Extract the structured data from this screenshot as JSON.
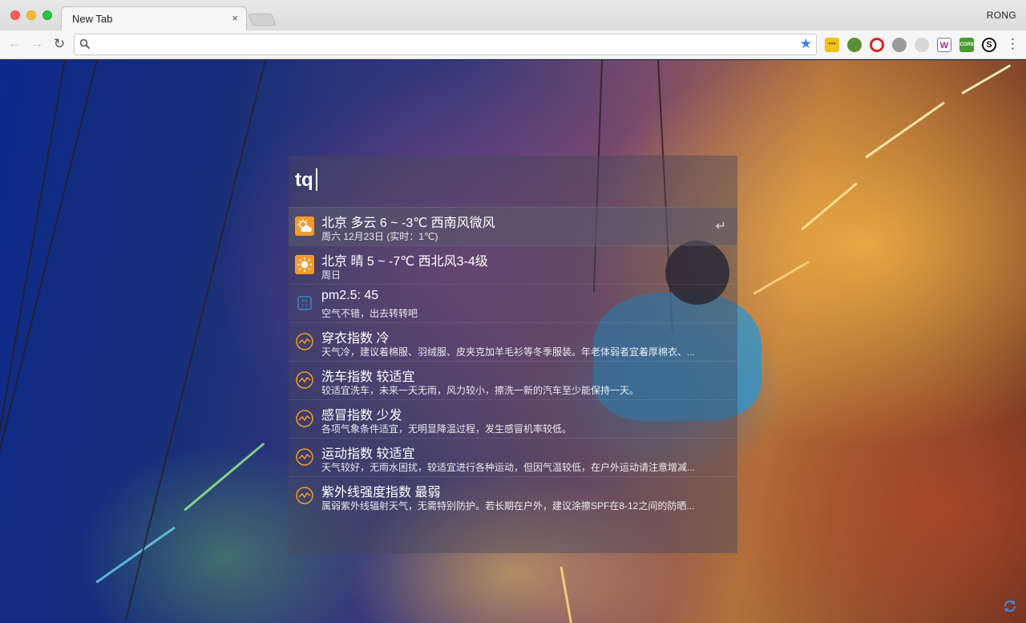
{
  "browser": {
    "tab_title": "New Tab",
    "tab_close": "×",
    "profile_name": "RONG",
    "omnibox_value": "",
    "nav": {
      "back": "←",
      "forward": "→",
      "reload": "↻"
    },
    "star": "★",
    "menu": "⋮",
    "extensions": [
      {
        "name": "notes-extension-icon",
        "glyph": "▪▪▪"
      },
      {
        "name": "apple-extension-icon",
        "glyph": ""
      },
      {
        "name": "opera-extension-icon",
        "glyph": ""
      },
      {
        "name": "compass-extension-icon",
        "glyph": ""
      },
      {
        "name": "cloud-extension-icon",
        "glyph": ""
      },
      {
        "name": "word-extension-icon",
        "glyph": "W"
      },
      {
        "name": "cors-extension-icon",
        "glyph": "CORS"
      },
      {
        "name": "s-extension-icon",
        "glyph": "S"
      }
    ]
  },
  "launcher": {
    "query": "tq",
    "enter_hint": "↵",
    "results": [
      {
        "icon": "partly-cloudy-icon",
        "title": "北京 多云 6 ~ -3℃ 西南风微风",
        "subtitle": "周六 12月23日 (实时：1℃)",
        "selected": true
      },
      {
        "icon": "sunny-icon",
        "title": "北京 晴 5 ~ -7℃ 西北风3-4级",
        "subtitle": "周日",
        "selected": false
      },
      {
        "icon": "pm25-icon",
        "title": "pm2.5: 45",
        "subtitle": "空气不错，出去转转吧",
        "selected": false
      },
      {
        "icon": "index-chart-icon",
        "title": "穿衣指数 冷",
        "subtitle": "天气冷，建议着棉服、羽绒服、皮夹克加羊毛衫等冬季服装。年老体弱者宜着厚棉衣、...",
        "selected": false
      },
      {
        "icon": "index-chart-icon",
        "title": "洗车指数 较适宜",
        "subtitle": "较适宜洗车，未来一天无雨，风力较小，擦洗一新的汽车至少能保持一天。",
        "selected": false
      },
      {
        "icon": "index-chart-icon",
        "title": "感冒指数 少发",
        "subtitle": "各项气象条件适宜，无明显降温过程，发生感冒机率较低。",
        "selected": false
      },
      {
        "icon": "index-chart-icon",
        "title": "运动指数 较适宜",
        "subtitle": "天气较好，无雨水困扰，较适宜进行各种运动，但因气温较低，在户外运动请注意增减...",
        "selected": false
      },
      {
        "icon": "index-chart-icon",
        "title": "紫外线强度指数 最弱",
        "subtitle": "属弱紫外线辐射天气，无需特别防护。若长期在户外，建议涂擦SPF在8-12之间的防晒...",
        "selected": false
      }
    ]
  },
  "colors": {
    "accent_orange": "#f39a2c",
    "star_blue": "#3b82f0"
  }
}
